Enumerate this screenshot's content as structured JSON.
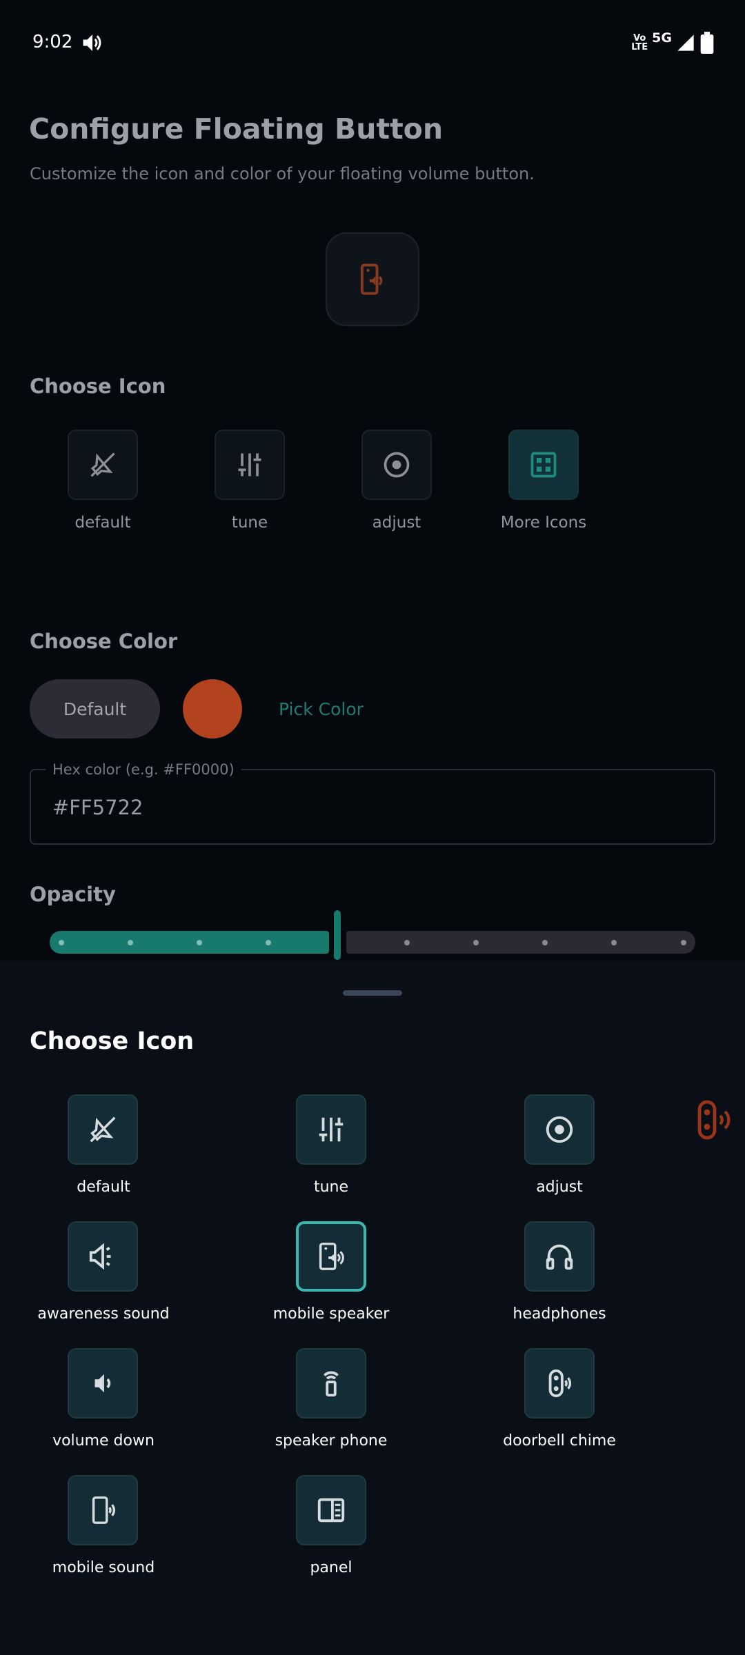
{
  "status_bar": {
    "time": "9:02",
    "volte_top": "Vo",
    "volte_bottom": "LTE",
    "network": "5G"
  },
  "page": {
    "title": "Configure Floating Button",
    "subtitle": "Customize the icon and color of your floating volume button."
  },
  "choose_icon_section": {
    "heading": "Choose Icon",
    "items": [
      {
        "label": "default",
        "icon": "speaker-off-icon"
      },
      {
        "label": "tune",
        "icon": "tune-icon"
      },
      {
        "label": "adjust",
        "icon": "adjust-icon"
      },
      {
        "label": "More Icons",
        "icon": "grid-icon"
      }
    ]
  },
  "choose_color_section": {
    "heading": "Choose Color",
    "default_label": "Default",
    "pick_color_label": "Pick Color",
    "swatch_color": "#b3421f"
  },
  "hex_field": {
    "label": "Hex color (e.g. #FF0000)",
    "value": "#FF5722"
  },
  "opacity_section": {
    "heading": "Opacity",
    "value_fraction": 0.42
  },
  "sheet": {
    "title": "Choose Icon",
    "items": [
      {
        "label": "default",
        "icon": "speaker-off-icon"
      },
      {
        "label": "tune",
        "icon": "tune-icon"
      },
      {
        "label": "adjust",
        "icon": "adjust-icon"
      },
      {
        "label": "awareness sound",
        "icon": "awareness-sound-icon"
      },
      {
        "label": "mobile speaker",
        "icon": "mobile-speaker-icon",
        "selected": true
      },
      {
        "label": "headphones",
        "icon": "headphones-icon"
      },
      {
        "label": "volume down",
        "icon": "volume-down-icon"
      },
      {
        "label": "speaker phone",
        "icon": "speaker-phone-icon"
      },
      {
        "label": "doorbell chime",
        "icon": "doorbell-chime-icon"
      },
      {
        "label": "mobile sound",
        "icon": "mobile-sound-icon"
      },
      {
        "label": "panel",
        "icon": "panel-icon"
      }
    ]
  },
  "colors": {
    "accent": "#177a6c",
    "selected_border": "#3bb9ae",
    "preview_icon": "#b3421f"
  }
}
